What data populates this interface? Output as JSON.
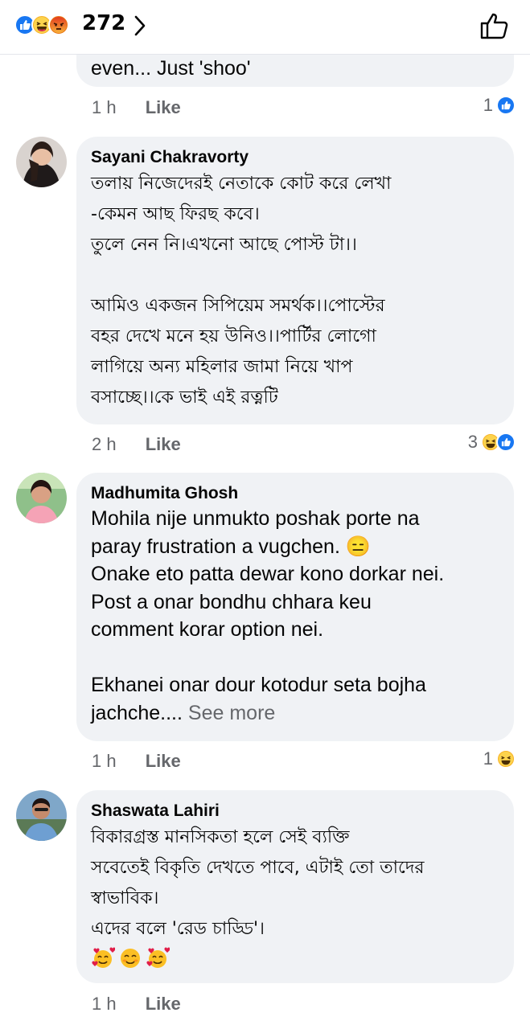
{
  "header": {
    "reaction_count": "272",
    "reaction_icons": [
      "like-icon",
      "haha-icon",
      "angry-icon"
    ]
  },
  "comments": [
    {
      "text": "even... Just 'shoo'",
      "time": "1 h",
      "like_label": "Like",
      "reaction_count": "1",
      "reaction_icons": [
        "like-icon"
      ]
    },
    {
      "author": "Sayani Chakravorty",
      "text": "তলায় নিজেদেরই নেতাকে কোট করে লেখা\n-কেমন আছ ফিরছ কবে।\nতুলে নেন নি।এখনো আছে পোস্ট টা।।\n\nআমিও একজন সিপিয়েম সমর্থক।।পোস্টের\nবহর দেখে মনে হয় উনিও।।পার্টির লোগো\nলাগিয়ে অন্য মহিলার জামা নিয়ে খাপ\nবসাচ্ছে।।কে ভাই এই রত্নটি",
      "time": "2 h",
      "like_label": "Like",
      "reaction_count": "3",
      "reaction_icons": [
        "haha-icon",
        "like-icon"
      ]
    },
    {
      "author": "Madhumita Ghosh",
      "text": "Mohila nije unmukto poshak porte na\nparay frustration a vugchen. 😑\nOnake eto patta dewar kono dorkar nei.\nPost a onar bondhu chhara keu\ncomment korar option nei.\n\nEkhanei onar dour kotodur seta bojha\njachche.... ",
      "see_more": "See more",
      "time": "1 h",
      "like_label": "Like",
      "reaction_count": "1",
      "reaction_icons": [
        "haha-icon"
      ]
    },
    {
      "author": "Shaswata Lahiri",
      "text": "বিকারগ্রস্ত মানসিকতা হলে সেই ব্যক্তি\nসবেতেই বিকৃতি দেখতে পাবে, এটাই তো তাদের\nস্বাভাবিক।\nএদের বলে 'রেড চাড্ডি'।",
      "emojis": [
        "smiling-face-with-hearts",
        "smiling-face",
        "smiling-face-with-hearts"
      ],
      "time": "1 h",
      "like_label": "Like"
    }
  ],
  "colors": {
    "bubble": "#f0f2f5",
    "meta_text": "#65676b",
    "like_blue": "#1877f2",
    "haha_yellow": "#f7b125",
    "angry_orange": "#e9710f"
  }
}
